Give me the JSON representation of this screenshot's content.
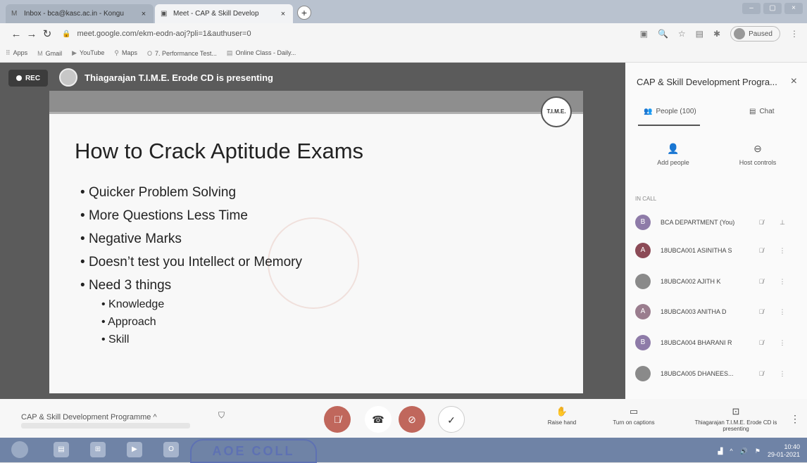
{
  "browser": {
    "tabs": [
      {
        "icon": "M",
        "label": "Inbox - bca@kasc.ac.in - Kongu",
        "close": "×"
      },
      {
        "icon": "▣",
        "label": "Meet - CAP & Skill Develop",
        "close": "×"
      }
    ],
    "new_tab": "+",
    "url": "meet.google.com/ekm-eodn-aoj?pli=1&authuser=0",
    "paused_label": "Paused",
    "bookmarks": [
      "Apps",
      "Gmail",
      "YouTube",
      "Maps",
      "7. Performance Test...",
      "Online Class - Daily..."
    ]
  },
  "stage": {
    "rec_label": "REC",
    "presenter_text": "Thiagarajan T.I.M.E. Erode CD is presenting"
  },
  "slide": {
    "logo_text": "T.I.M.E.",
    "title": "How to Crack Aptitude Exams",
    "bullets": [
      "Quicker Problem Solving",
      "More Questions Less Time",
      "Negative Marks",
      "Doesn’t test you Intellect or Memory",
      "Need 3 things"
    ],
    "sub_bullets": [
      "Knowledge",
      "Approach",
      "Skill"
    ]
  },
  "panel": {
    "title": "CAP & Skill Development Progra...",
    "close": "×",
    "people_tab": "People (100)",
    "chat_tab": "Chat",
    "add_people": "Add people",
    "host_controls": "Host controls",
    "in_call": "IN CALL",
    "participants": [
      {
        "initial": "B",
        "name": "BCA DEPARTMENT (You)",
        "color": "#8e7ba8"
      },
      {
        "initial": "A",
        "name": "18UBCA001 ASINITHA S",
        "color": "#8c4b57"
      },
      {
        "initial": "",
        "name": "18UBCA002 AJITH K",
        "color": "#8a8a8a"
      },
      {
        "initial": "A",
        "name": "18UBCA003 ANITHA D",
        "color": "#9a7d8e"
      },
      {
        "initial": "B",
        "name": "18UBCA004 BHARANI R",
        "color": "#8e7ba8"
      },
      {
        "initial": "",
        "name": "18UBCA005 DHANEES...",
        "color": "#8a8a8a"
      }
    ]
  },
  "bottombar": {
    "meeting_name": "CAP & Skill Development Programme ^",
    "raise_hand": "Raise hand",
    "captions": "Turn on captions",
    "presenting": "Thiagarajan T.I.M.E. Erode CD is presenting"
  },
  "taskbar": {
    "stamp_text": "AOE COLL",
    "time": "10:40",
    "date": "29-01-2021"
  }
}
